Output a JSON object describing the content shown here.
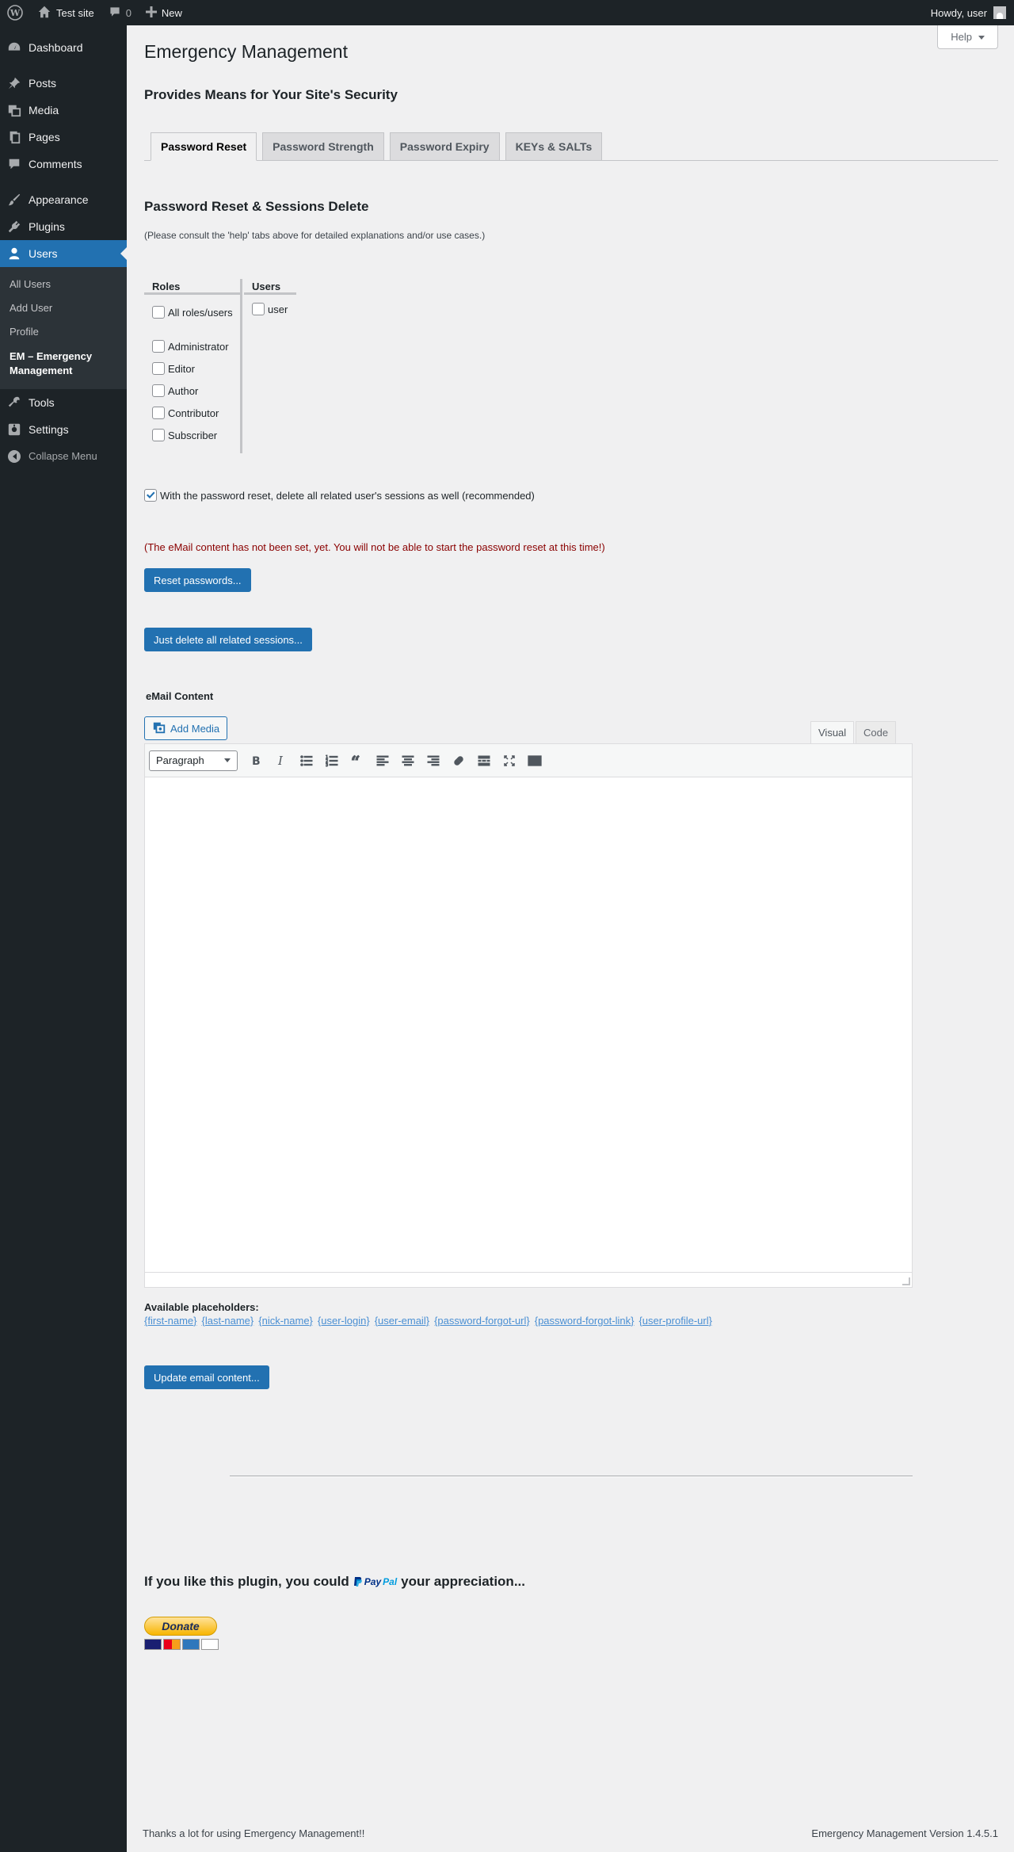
{
  "admin_bar": {
    "site_name": "Test site",
    "comments_count": "0",
    "new_label": "New",
    "greeting": "Howdy, user"
  },
  "sidebar": {
    "items": [
      {
        "label": "Dashboard",
        "icon": "dashboard-icon"
      },
      {
        "label": "Posts",
        "icon": "pin-icon"
      },
      {
        "label": "Media",
        "icon": "media-icon"
      },
      {
        "label": "Pages",
        "icon": "pages-icon"
      },
      {
        "label": "Comments",
        "icon": "comment-icon"
      },
      {
        "label": "Appearance",
        "icon": "paintbrush-icon"
      },
      {
        "label": "Plugins",
        "icon": "plugin-icon"
      },
      {
        "label": "Users",
        "icon": "user-icon"
      },
      {
        "label": "Tools",
        "icon": "wrench-icon"
      },
      {
        "label": "Settings",
        "icon": "settings-icon"
      }
    ],
    "users_submenu": [
      "All Users",
      "Add User",
      "Profile",
      "EM – Emergency Management"
    ],
    "collapse_label": "Collapse Menu"
  },
  "page": {
    "help_label": "Help",
    "title": "Emergency Management",
    "subtitle": "Provides Means for Your Site's Security",
    "tabs": [
      "Password Reset",
      "Password Strength",
      "Password Expiry",
      "KEYs & SALTs"
    ],
    "section_title": "Password Reset & Sessions Delete",
    "note": "(Please consult the 'help' tabs above for detailed explanations and/or use cases.)",
    "roles_header": "Roles",
    "users_header": "Users",
    "roles": [
      "All roles/users",
      "Administrator",
      "Editor",
      "Author",
      "Contributor",
      "Subscriber"
    ],
    "users": [
      "user"
    ],
    "session_option": "With the password reset, delete all related user's sessions as well (recommended)",
    "session_option_checked": true,
    "warning": "(The eMail content has not been set, yet. You will not be able to start the password reset at this time!)",
    "reset_button": "Reset passwords...",
    "sessions_button": "Just delete all related sessions...",
    "email_label": "eMail Content",
    "add_media": "Add Media",
    "editor_tabs": [
      "Visual",
      "Code"
    ],
    "format_select": "Paragraph",
    "placeholders_title": "Available placeholders:",
    "placeholders": [
      "{first-name}",
      "{last-name}",
      "{nick-name}",
      "{user-login}",
      "{user-email}",
      "{password-forgot-url}",
      "{password-forgot-link}",
      "{user-profile-url}"
    ],
    "update_button": "Update email content...",
    "appreciation_before": "If you like this plugin, you could",
    "paypal_1": "Pay",
    "paypal_2": "Pal",
    "appreciation_after": "your appreciation...",
    "donate_label": "Donate"
  },
  "footer": {
    "left": "Thanks a lot for using Emergency Management!!",
    "right": "Emergency Management Version 1.4.5.1"
  },
  "colors": {
    "admin_dark": "#1d2327",
    "accent": "#2271b1",
    "warning": "#8a0000"
  }
}
